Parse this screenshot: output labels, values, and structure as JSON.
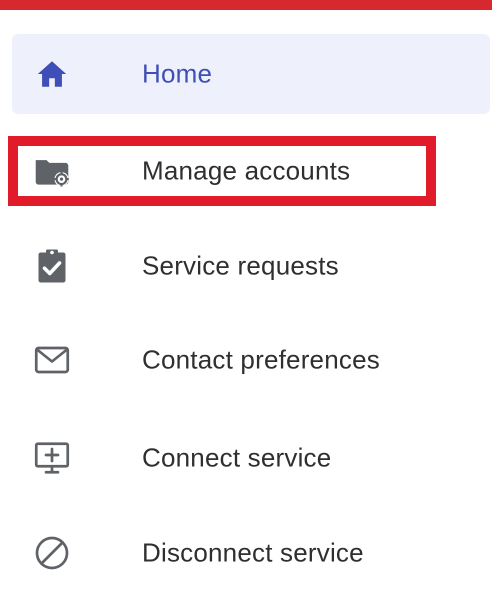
{
  "colors": {
    "accent_top_bar": "#d7282f",
    "highlight": "#e21b2a",
    "active_bg": "#eef1fb",
    "active_text": "#3f4fb7",
    "text": "#2f2f2f",
    "icon_gray": "#5f6368"
  },
  "nav": {
    "items": [
      {
        "label": "Home",
        "icon": "home-icon",
        "active": true
      },
      {
        "label": "Manage accounts",
        "icon": "folder-gear-icon",
        "active": false
      },
      {
        "label": "Service requests",
        "icon": "clipboard-check-icon",
        "active": false
      },
      {
        "label": "Contact preferences",
        "icon": "mail-icon",
        "active": false
      },
      {
        "label": "Connect service",
        "icon": "monitor-plus-icon",
        "active": false
      },
      {
        "label": "Disconnect service",
        "icon": "block-icon",
        "active": false
      }
    ]
  }
}
